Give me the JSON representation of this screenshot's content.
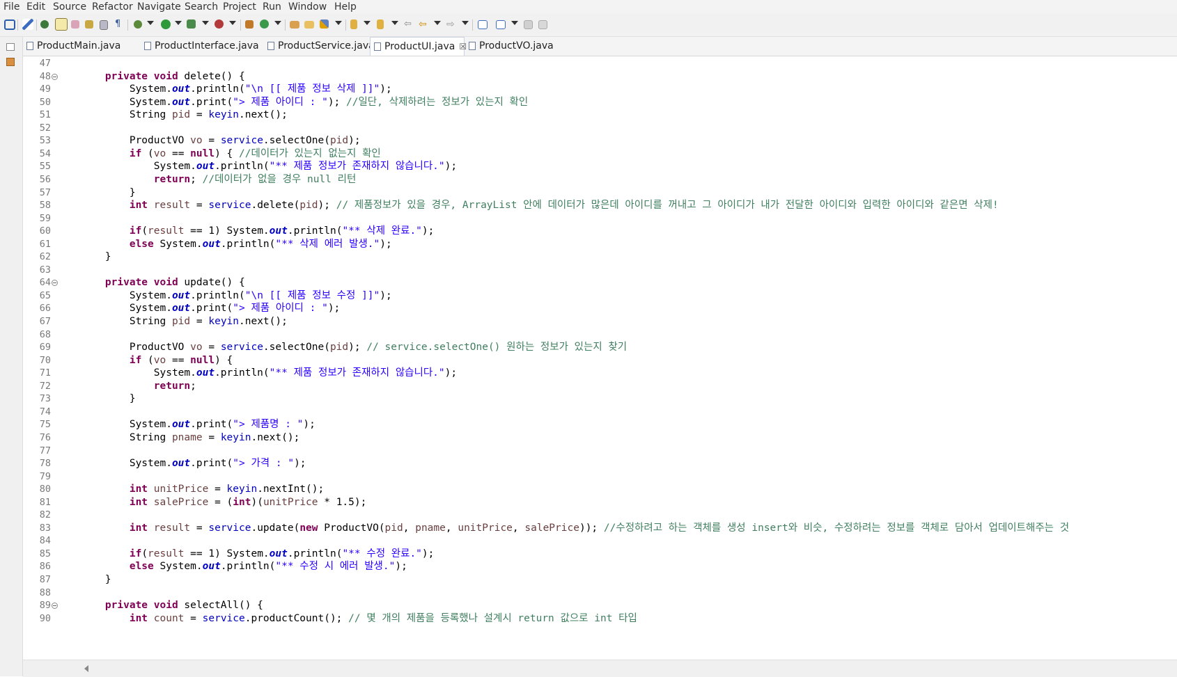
{
  "menu": [
    "File",
    "Edit",
    "Source",
    "Refactor",
    "Navigate",
    "Search",
    "Project",
    "Run",
    "Window",
    "Help"
  ],
  "tabs": [
    {
      "label": "ProductMain.java",
      "active": false
    },
    {
      "label": "ProductInterface.java",
      "active": false
    },
    {
      "label": "ProductService.java",
      "active": false
    },
    {
      "label": "ProductUI.java",
      "active": true,
      "close": "☒"
    },
    {
      "label": "ProductVO.java",
      "active": false
    }
  ],
  "colors": {
    "keyword": "#7f0055",
    "string": "#2a00ff",
    "comment": "#3f7f5f",
    "field": "#0000c0",
    "local": "#6a3e3e",
    "line_number": "#787878"
  },
  "editor": {
    "lines": [
      {
        "n": "47",
        "fold": false,
        "segs": []
      },
      {
        "n": "48",
        "fold": true,
        "segs": [
          [
            "kw",
            "    private void"
          ],
          [
            "",
            " delete() {"
          ]
        ]
      },
      {
        "n": "49",
        "fold": false,
        "segs": [
          [
            "",
            "        System."
          ],
          [
            "sf",
            "out"
          ],
          [
            "",
            ".println("
          ],
          [
            "st",
            "\"\\n [[ 제품 정보 삭제 ]]\""
          ],
          [
            "",
            ");"
          ]
        ]
      },
      {
        "n": "50",
        "fold": false,
        "segs": [
          [
            "",
            "        System."
          ],
          [
            "sf",
            "out"
          ],
          [
            "",
            ".print("
          ],
          [
            "st",
            "\"> 제품 아이디 : \""
          ],
          [
            "",
            ");"
          ],
          [
            "cm",
            " //일단, 삭제하려는 정보가 있는지 확인"
          ]
        ]
      },
      {
        "n": "51",
        "fold": false,
        "segs": [
          [
            "",
            "        String "
          ],
          [
            "lv",
            "pid"
          ],
          [
            "",
            " = "
          ],
          [
            "fd",
            "keyin"
          ],
          [
            "",
            ".next();"
          ]
        ]
      },
      {
        "n": "52",
        "fold": false,
        "segs": []
      },
      {
        "n": "53",
        "fold": false,
        "segs": [
          [
            "",
            "        ProductVO "
          ],
          [
            "lv",
            "vo"
          ],
          [
            "",
            " = "
          ],
          [
            "fd",
            "service"
          ],
          [
            "",
            ".selectOne("
          ],
          [
            "lv",
            "pid"
          ],
          [
            "",
            ");"
          ]
        ]
      },
      {
        "n": "54",
        "fold": false,
        "segs": [
          [
            "kw",
            "        if"
          ],
          [
            "",
            " ("
          ],
          [
            "lv",
            "vo"
          ],
          [
            "",
            " == "
          ],
          [
            "kw",
            "null"
          ],
          [
            "",
            ") { "
          ],
          [
            "cm",
            "//데이터가 있는지 없는지 확인"
          ]
        ]
      },
      {
        "n": "55",
        "fold": false,
        "segs": [
          [
            "",
            "            System."
          ],
          [
            "sf",
            "out"
          ],
          [
            "",
            ".println("
          ],
          [
            "st",
            "\"** 제품 정보가 존재하지 않습니다.\""
          ],
          [
            "",
            ");"
          ]
        ]
      },
      {
        "n": "56",
        "fold": false,
        "segs": [
          [
            "kw",
            "            return"
          ],
          [
            "",
            "; "
          ],
          [
            "cm",
            "//데이터가 없을 경우 null 리턴"
          ]
        ]
      },
      {
        "n": "57",
        "fold": false,
        "segs": [
          [
            "",
            "        }"
          ]
        ]
      },
      {
        "n": "58",
        "fold": false,
        "segs": [
          [
            "kw",
            "        int"
          ],
          [
            "",
            " "
          ],
          [
            "lv",
            "result"
          ],
          [
            "",
            " = "
          ],
          [
            "fd",
            "service"
          ],
          [
            "",
            ".delete("
          ],
          [
            "lv",
            "pid"
          ],
          [
            "",
            "); "
          ],
          [
            "cm",
            "// 제품정보가 있을 경우, ArrayList 안에 데이터가 많은데 아이디를 꺼내고 그 아이디가 내가 전달한 아이디와 입력한 아이디와 같은면 삭제!"
          ]
        ]
      },
      {
        "n": "59",
        "fold": false,
        "segs": []
      },
      {
        "n": "60",
        "fold": false,
        "segs": [
          [
            "kw",
            "        if"
          ],
          [
            "",
            "("
          ],
          [
            "lv",
            "result"
          ],
          [
            "",
            " == 1) System."
          ],
          [
            "sf",
            "out"
          ],
          [
            "",
            ".println("
          ],
          [
            "st",
            "\"** 삭제 완료.\""
          ],
          [
            "",
            ");"
          ]
        ]
      },
      {
        "n": "61",
        "fold": false,
        "segs": [
          [
            "kw",
            "        else"
          ],
          [
            "",
            " System."
          ],
          [
            "sf",
            "out"
          ],
          [
            "",
            ".println("
          ],
          [
            "st",
            "\"** 삭제 에러 발생.\""
          ],
          [
            "",
            ");"
          ]
        ]
      },
      {
        "n": "62",
        "fold": false,
        "segs": [
          [
            "",
            "    }"
          ]
        ]
      },
      {
        "n": "63",
        "fold": false,
        "segs": []
      },
      {
        "n": "64",
        "fold": true,
        "segs": [
          [
            "kw",
            "    private void"
          ],
          [
            "",
            " update() {"
          ]
        ]
      },
      {
        "n": "65",
        "fold": false,
        "segs": [
          [
            "",
            "        System."
          ],
          [
            "sf",
            "out"
          ],
          [
            "",
            ".println("
          ],
          [
            "st",
            "\"\\n [[ 제품 정보 수정 ]]\""
          ],
          [
            "",
            ");"
          ]
        ]
      },
      {
        "n": "66",
        "fold": false,
        "segs": [
          [
            "",
            "        System."
          ],
          [
            "sf",
            "out"
          ],
          [
            "",
            ".print("
          ],
          [
            "st",
            "\"> 제품 아이디 : \""
          ],
          [
            "",
            ");"
          ]
        ]
      },
      {
        "n": "67",
        "fold": false,
        "segs": [
          [
            "",
            "        String "
          ],
          [
            "lv",
            "pid"
          ],
          [
            "",
            " = "
          ],
          [
            "fd",
            "keyin"
          ],
          [
            "",
            ".next();"
          ]
        ]
      },
      {
        "n": "68",
        "fold": false,
        "segs": []
      },
      {
        "n": "69",
        "fold": false,
        "segs": [
          [
            "",
            "        ProductVO "
          ],
          [
            "lv",
            "vo"
          ],
          [
            "",
            " = "
          ],
          [
            "fd",
            "service"
          ],
          [
            "",
            ".selectOne("
          ],
          [
            "lv",
            "pid"
          ],
          [
            "",
            "); "
          ],
          [
            "cm",
            "// service.selectOne() 원하는 정보가 있는지 찾기"
          ]
        ]
      },
      {
        "n": "70",
        "fold": false,
        "segs": [
          [
            "kw",
            "        if"
          ],
          [
            "",
            " ("
          ],
          [
            "lv",
            "vo"
          ],
          [
            "",
            " == "
          ],
          [
            "kw",
            "null"
          ],
          [
            "",
            ") {"
          ]
        ]
      },
      {
        "n": "71",
        "fold": false,
        "segs": [
          [
            "",
            "            System."
          ],
          [
            "sf",
            "out"
          ],
          [
            "",
            ".println("
          ],
          [
            "st",
            "\"** 제품 정보가 존재하지 않습니다.\""
          ],
          [
            "",
            ");"
          ]
        ]
      },
      {
        "n": "72",
        "fold": false,
        "segs": [
          [
            "kw",
            "            return"
          ],
          [
            "",
            ";"
          ]
        ]
      },
      {
        "n": "73",
        "fold": false,
        "segs": [
          [
            "",
            "        }"
          ]
        ]
      },
      {
        "n": "74",
        "fold": false,
        "segs": []
      },
      {
        "n": "75",
        "fold": false,
        "segs": [
          [
            "",
            "        System."
          ],
          [
            "sf",
            "out"
          ],
          [
            "",
            ".print("
          ],
          [
            "st",
            "\"> 제품명 : \""
          ],
          [
            "",
            ");"
          ]
        ]
      },
      {
        "n": "76",
        "fold": false,
        "segs": [
          [
            "",
            "        String "
          ],
          [
            "lv",
            "pname"
          ],
          [
            "",
            " = "
          ],
          [
            "fd",
            "keyin"
          ],
          [
            "",
            ".next();"
          ]
        ]
      },
      {
        "n": "77",
        "fold": false,
        "segs": []
      },
      {
        "n": "78",
        "fold": false,
        "segs": [
          [
            "",
            "        System."
          ],
          [
            "sf",
            "out"
          ],
          [
            "",
            ".print("
          ],
          [
            "st",
            "\"> 가격 : \""
          ],
          [
            "",
            ");"
          ]
        ]
      },
      {
        "n": "79",
        "fold": false,
        "segs": []
      },
      {
        "n": "80",
        "fold": false,
        "segs": [
          [
            "kw",
            "        int"
          ],
          [
            "",
            " "
          ],
          [
            "lv",
            "unitPrice"
          ],
          [
            "",
            " = "
          ],
          [
            "fd",
            "keyin"
          ],
          [
            "",
            ".nextInt();"
          ]
        ]
      },
      {
        "n": "81",
        "fold": false,
        "segs": [
          [
            "kw",
            "        int"
          ],
          [
            "",
            " "
          ],
          [
            "lv",
            "salePrice"
          ],
          [
            "",
            " = ("
          ],
          [
            "kw",
            "int"
          ],
          [
            "",
            ")("
          ],
          [
            "lv",
            "unitPrice"
          ],
          [
            "",
            " * 1.5);"
          ]
        ]
      },
      {
        "n": "82",
        "fold": false,
        "segs": []
      },
      {
        "n": "83",
        "fold": false,
        "segs": [
          [
            "kw",
            "        int"
          ],
          [
            "",
            " "
          ],
          [
            "lv",
            "result"
          ],
          [
            "",
            " = "
          ],
          [
            "fd",
            "service"
          ],
          [
            "",
            ".update("
          ],
          [
            "kw",
            "new"
          ],
          [
            "",
            " ProductVO("
          ],
          [
            "lv",
            "pid"
          ],
          [
            "",
            ", "
          ],
          [
            "lv",
            "pname"
          ],
          [
            "",
            ", "
          ],
          [
            "lv",
            "unitPrice"
          ],
          [
            "",
            ", "
          ],
          [
            "lv",
            "salePrice"
          ],
          [
            "",
            "));"
          ],
          [
            "cm",
            " //수정하려고 하는 객체를 생성 insert와 비슷, 수정하려는 정보를 객체로 담아서 업데이트해주는 것"
          ]
        ]
      },
      {
        "n": "84",
        "fold": false,
        "segs": []
      },
      {
        "n": "85",
        "fold": false,
        "segs": [
          [
            "kw",
            "        if"
          ],
          [
            "",
            "("
          ],
          [
            "lv",
            "result"
          ],
          [
            "",
            " == 1) System."
          ],
          [
            "sf",
            "out"
          ],
          [
            "",
            ".println("
          ],
          [
            "st",
            "\"** 수정 완료.\""
          ],
          [
            "",
            ");"
          ]
        ]
      },
      {
        "n": "86",
        "fold": false,
        "segs": [
          [
            "kw",
            "        else"
          ],
          [
            "",
            " System."
          ],
          [
            "sf",
            "out"
          ],
          [
            "",
            ".println("
          ],
          [
            "st",
            "\"** 수정 시 에러 발생.\""
          ],
          [
            "",
            ");"
          ]
        ]
      },
      {
        "n": "87",
        "fold": false,
        "segs": [
          [
            "",
            "    }"
          ]
        ]
      },
      {
        "n": "88",
        "fold": false,
        "segs": []
      },
      {
        "n": "89",
        "fold": true,
        "segs": [
          [
            "kw",
            "    private void"
          ],
          [
            "",
            " selectAll() {"
          ]
        ]
      },
      {
        "n": "90",
        "fold": false,
        "segs": [
          [
            "kw",
            "        int"
          ],
          [
            "",
            " "
          ],
          [
            "lv",
            "count"
          ],
          [
            "",
            " = "
          ],
          [
            "fd",
            "service"
          ],
          [
            "",
            ".productCount(); "
          ],
          [
            "cm",
            "// 몇 개의 제품을 등록했나 설계시 return 값으로 int 타입"
          ]
        ]
      }
    ]
  }
}
